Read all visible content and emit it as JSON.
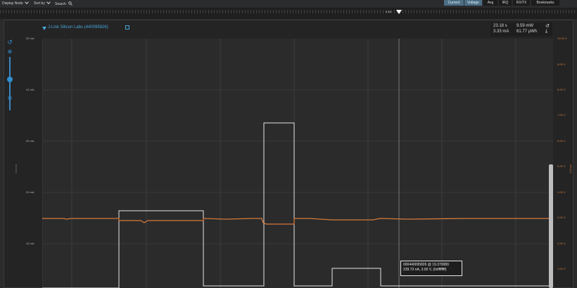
{
  "toolbar": {
    "display_mode": "Display Node",
    "sort_by": "Sort by",
    "search": "Search",
    "tabs": [
      "Current",
      "Voltage",
      "Avg",
      "IRQ",
      "RX/TX",
      "Bookmarks"
    ],
    "active_tabs": [
      "Current",
      "Voltage"
    ]
  },
  "timeline": {
    "marker_label": "4.18"
  },
  "device": {
    "title": "J-Link Silicon Labs (440095826)"
  },
  "readout": {
    "time": "23.18 s",
    "power": "9.59 mW",
    "current": "3.33 mA",
    "energy": "61.77 µWh"
  },
  "axes": {
    "left_title": "Current",
    "right_title": "Voltage",
    "left_ticks": [
      "32 mA",
      "41 mA",
      "30 mA",
      "20 mA",
      "10 mA"
    ],
    "right_ticks": [
      "10.00 V",
      "9.00 V",
      "8.00 V",
      "7.00 V",
      "6.00 V",
      "5.00 V",
      "4.00 V",
      "3.00 V",
      "2.00 V",
      "1.00 V"
    ]
  },
  "tooltip": {
    "line1": "000440095826 @ 19.370080",
    "line2": "239.73 nA, 3.00 V, (0xffffffff)"
  },
  "colors": {
    "accent": "#46a6d9",
    "current_trace": "#e6e6e6",
    "voltage_trace": "#d57a3a"
  },
  "icons": {
    "reset": "undo-icon",
    "zoom_in": "zoom-in-icon",
    "zoom_out": "zoom-out-icon",
    "download": "download-icon"
  }
}
